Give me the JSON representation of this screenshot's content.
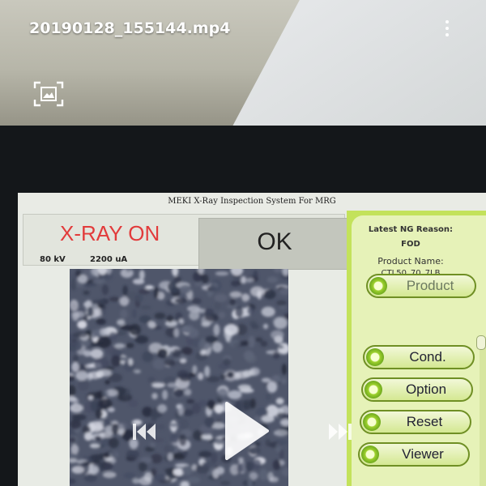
{
  "video_player": {
    "file_name": "20190128_155144.mp4"
  },
  "inspection_screen": {
    "system_title": "MEKI X-Ray Inspection System For MRG",
    "xray_status": "X-RAY ON",
    "voltage": "80 kV",
    "current": "2200 uA",
    "result": "OK",
    "latest_ng_title": "Latest NG Reason:",
    "latest_ng_reason": "FOD",
    "product_name_label": "Product Name:",
    "product_name_value": "CTL50_70_7LB",
    "buttons": {
      "product": "Product",
      "cond": "Cond.",
      "option": "Option",
      "reset": "Reset",
      "viewer": "Viewer"
    }
  },
  "colors": {
    "xray_status": "#e23b3b",
    "panel_green": "#c3e25b",
    "button_border": "#6f8f24"
  },
  "icons": [
    "more-vert-icon",
    "screenshot-icon",
    "skip-previous-icon",
    "play-icon",
    "skip-next-icon",
    "button-indicator-icon"
  ]
}
